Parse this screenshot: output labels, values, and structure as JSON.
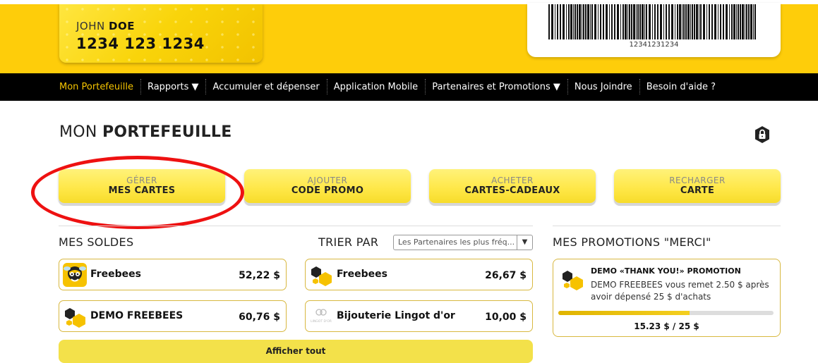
{
  "member_card": {
    "first_name": "JOHN",
    "last_name": "DOE",
    "number": "1234 123 1234"
  },
  "barcode": {
    "number": "12341231234"
  },
  "nav": {
    "items": [
      {
        "label": "Mon Portefeuille",
        "active": true
      },
      {
        "label": "Rapports ▼"
      },
      {
        "label": "Accumuler et dépenser"
      },
      {
        "label": "Application Mobile"
      },
      {
        "label": "Partenaires et Promotions ▼"
      },
      {
        "label": "Nous Joindre"
      },
      {
        "label": "Besoin d'aide ?"
      }
    ]
  },
  "page_title": {
    "normal": "MON",
    "bold": "PORTEFEUILLE"
  },
  "actions": [
    {
      "line1": "GÉRER",
      "line2": "MES CARTES"
    },
    {
      "line1": "AJOUTER",
      "line2": "CODE PROMO"
    },
    {
      "line1": "ACHETER",
      "line2": "CARTES-CADEAUX"
    },
    {
      "line1": "RECHARGER",
      "line2": "CARTE"
    }
  ],
  "balances": {
    "title": "MES SOLDES",
    "items": [
      {
        "name": "Freebees",
        "amount": "52,22 $"
      },
      {
        "name": "DEMO FREEBEES",
        "amount": "60,76 $"
      }
    ]
  },
  "sort": {
    "title": "TRIER PAR",
    "selected": "Les Partenaires les plus fréq...",
    "items": [
      {
        "name": "Freebees",
        "amount": "26,67 $"
      },
      {
        "name": "Bijouterie Lingot d'or",
        "amount": "10,00 $",
        "logo_text": "LINGOT D'OR"
      }
    ]
  },
  "show_all_label": "Afficher tout",
  "promotions": {
    "title": "MES PROMOTIONS \"MERCI\"",
    "item": {
      "title": "DEMO «THANK YOU!» PROMOTION",
      "description": "DEMO FREEBEES vous remet 2.50 $ après avoir dépensé 25 $ d'achats",
      "progress_current": 15.23,
      "progress_total": 25,
      "progress_text": "15.23 $ / 25 $"
    }
  },
  "colors": {
    "brand_yellow": "#fecd0a",
    "nav_bg": "#000000",
    "nav_active": "#f5c400",
    "highlight_ring": "#e11111"
  }
}
